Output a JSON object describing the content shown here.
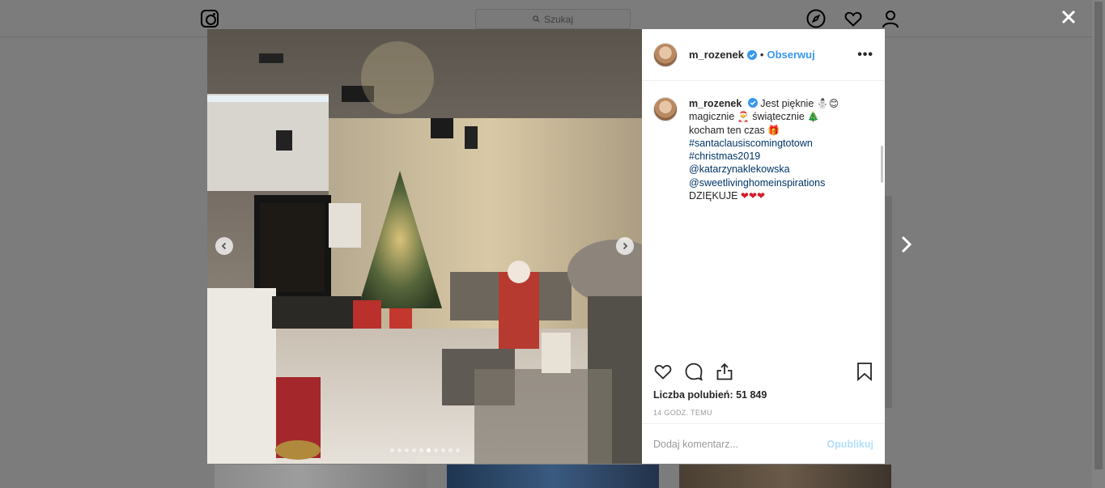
{
  "header": {
    "search_placeholder": "Szukaj",
    "icons": [
      "instagram-logo-icon",
      "search-icon",
      "compass-icon",
      "heart-icon",
      "profile-icon"
    ]
  },
  "post": {
    "username": "m_rozenek",
    "follow_label": "Obserwuj",
    "separator": "•",
    "more_label": "•••",
    "caption": {
      "username": "m_rozenek",
      "text_line1": "Jest pięknie",
      "emoji1": "⛄😊",
      "text_line2": "magicznie",
      "emoji2": "🎅",
      "text_line2b": "świątecznie",
      "emoji3": "🎄",
      "text_line3": "kocham ten czas",
      "emoji4": "🎁",
      "tags": [
        "#santaclausiscomingtotown",
        "#christmas2019",
        "@katarzynaklekowska",
        "@sweetlivinghomeinspirations"
      ],
      "text_last": "DZIĘKUJE",
      "emoji_last": "❤❤❤"
    },
    "likes_label": "Liczba polubień: 51 849",
    "time_label": "14 GODZ. TEMU",
    "comment_placeholder": "Dodaj komentarz...",
    "publish_label": "Opublikuj",
    "carousel": {
      "total": 10,
      "active_index": 5
    }
  },
  "colors": {
    "accent": "#3897f0",
    "link": "#003569",
    "publish_disabled": "#b2dffc",
    "overlay": "#7c7c7c"
  }
}
